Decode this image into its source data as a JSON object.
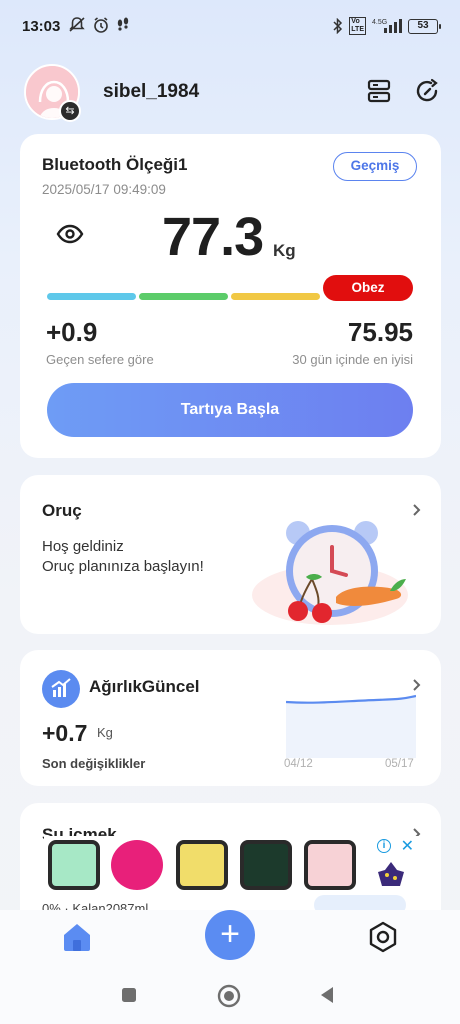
{
  "status_bar": {
    "time": "13:03",
    "lte_label": "4.5G",
    "battery": "53"
  },
  "header": {
    "username": "sibel_1984"
  },
  "scale_card": {
    "title": "Bluetooth Ölçeği1",
    "datetime": "2025/05/17 09:49:09",
    "history_label": "Geçmiş",
    "weight": "77.3",
    "unit": "Kg",
    "bmi_status": "Obez",
    "bmi_colors": [
      "#5ec8ea",
      "#5ccc6a",
      "#f1c844",
      "#e10e0e"
    ],
    "change_value": "+0.9",
    "change_label": "Geçen sefere göre",
    "best_value": "75.95",
    "best_label": "30 gün içinde en iyisi",
    "start_label": "Tartıya Başla"
  },
  "fasting_card": {
    "title": "Oruç",
    "line1": "Hoş geldiniz",
    "line2": "Oruç planınıza başlayın!"
  },
  "weight_trend_card": {
    "title": "AğırlıkGüncel",
    "value": "+0.7",
    "unit": "Kg",
    "label": "Son değişiklikler",
    "date_start": "04/12",
    "date_end": "05/17"
  },
  "water_card": {
    "title": "Su içmek",
    "subtitle": "0% · Kalan2087ml"
  },
  "ad": {
    "info_label": "i",
    "close_label": "✕",
    "tile_colors": [
      "#a7e8c6",
      "#e8207a",
      "#f1dd6a",
      "#1c3a2c",
      "#f7d2d6"
    ]
  },
  "bottom_nav": {
    "add_label": "+"
  }
}
